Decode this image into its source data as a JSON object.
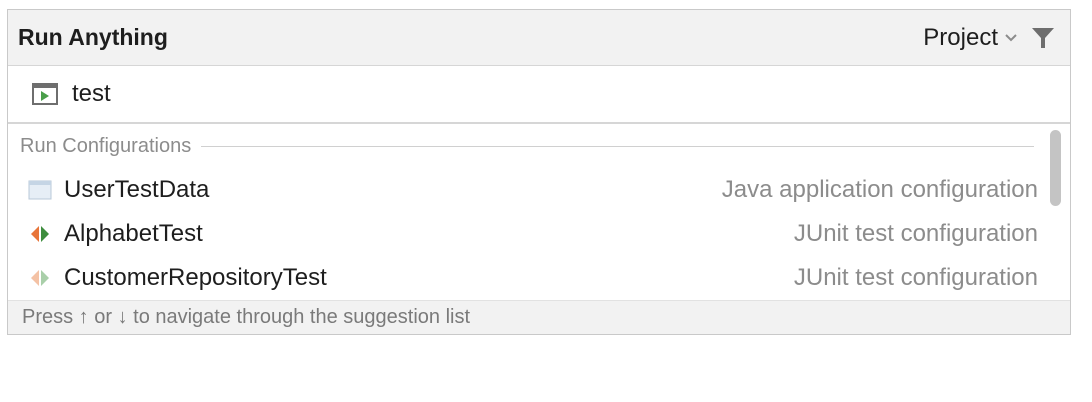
{
  "header": {
    "title": "Run Anything",
    "scope_label": "Project",
    "scope_icon": "chevron-down-icon",
    "filter_icon": "filter-icon"
  },
  "search": {
    "value": "test",
    "placeholder": "",
    "icon": "run-terminal-icon"
  },
  "results": {
    "group_label": "Run Configurations",
    "items": [
      {
        "name": "UserTestData",
        "type": "Java application configuration",
        "icon": "java-application-icon"
      },
      {
        "name": "AlphabetTest",
        "type": "JUnit test configuration",
        "icon": "junit-icon"
      },
      {
        "name": "CustomerRepositoryTest",
        "type": "JUnit test configuration",
        "icon": "junit-icon"
      }
    ]
  },
  "footer": {
    "hint": "Press ↑ or ↓ to navigate through the suggestion list"
  },
  "colors": {
    "header_bg": "#f2f2f2",
    "secondary_text": "#8c8c8c",
    "junit_orange": "#e8753a",
    "junit_green": "#3e8d3e",
    "run_green": "#4a9e4a"
  }
}
